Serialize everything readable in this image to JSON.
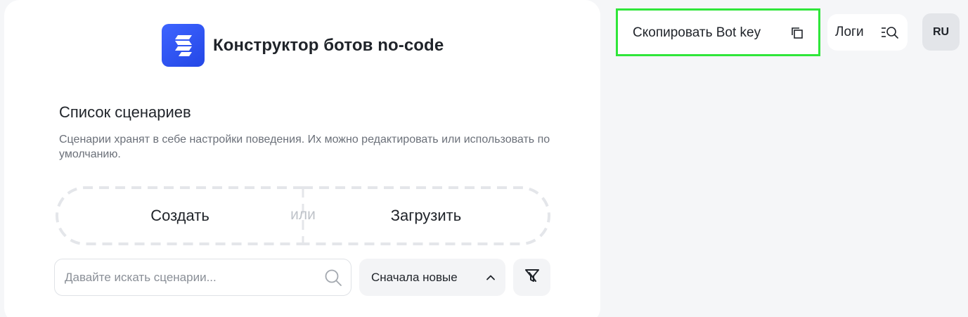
{
  "brand": {
    "title": "Конструктор ботов no-code",
    "logo_icon": "stacked-stripes-logo",
    "accent_color": "#2f56f5"
  },
  "scenarios": {
    "title": "Список сценариев",
    "description": "Сценарии хранят в себе настройки поведения. Их можно редактировать или использовать по умолчанию.",
    "create_label": "Создать",
    "or_label": "или",
    "upload_label": "Загрузить"
  },
  "search": {
    "placeholder": "Давайте искать сценарии...",
    "value": "",
    "icon": "search-icon"
  },
  "sort": {
    "selected": "Сначала новые",
    "icon": "chevron-up-icon"
  },
  "filter": {
    "icon": "filter-icon"
  },
  "topbar": {
    "copy_bot_key_label": "Скопировать Bot key",
    "copy_icon": "copy-icon",
    "logs_label": "Логи",
    "logs_icon": "list-search-icon",
    "language": "RU",
    "highlight_color": "#2fe63a"
  }
}
